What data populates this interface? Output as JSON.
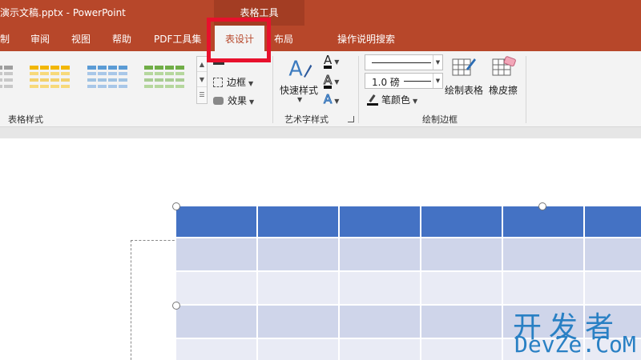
{
  "title_bar": {
    "document_title": "演示文稿.pptx  -  PowerPoint",
    "context_tools_label": "表格工具"
  },
  "tabs": {
    "items": [
      "制",
      "审阅",
      "视图",
      "帮助",
      "PDF工具集"
    ],
    "active": "表设计",
    "after_active": [
      "布局"
    ],
    "tell_me": "操作说明搜索",
    "tell_me_icon": "lightbulb-icon"
  },
  "ribbon": {
    "table_styles": {
      "label": "表格样式",
      "thumbnail_colors": [
        "#9e9e9e",
        "#f2b701",
        "#5b9bd5",
        "#70ad47"
      ],
      "options": [
        {
          "label": "",
          "icon": "shading-icon"
        },
        {
          "label": "边框",
          "icon": "border-icon"
        },
        {
          "label": "效果",
          "icon": "effects-icon"
        }
      ]
    },
    "wordart_styles": {
      "label": "艺术字样式",
      "quick_styles_label": "快速样式",
      "icons": [
        "text-fill-icon",
        "text-outline-icon",
        "text-effects-icon"
      ]
    },
    "draw_borders": {
      "label": "绘制边框",
      "pen_weight": "1.0 磅",
      "pen_color_label": "笔颜色",
      "draw_table_label": "绘制表格",
      "eraser_label": "橡皮擦"
    }
  },
  "watermark": {
    "cn": "开发者",
    "en": "DevZe.CoM"
  }
}
